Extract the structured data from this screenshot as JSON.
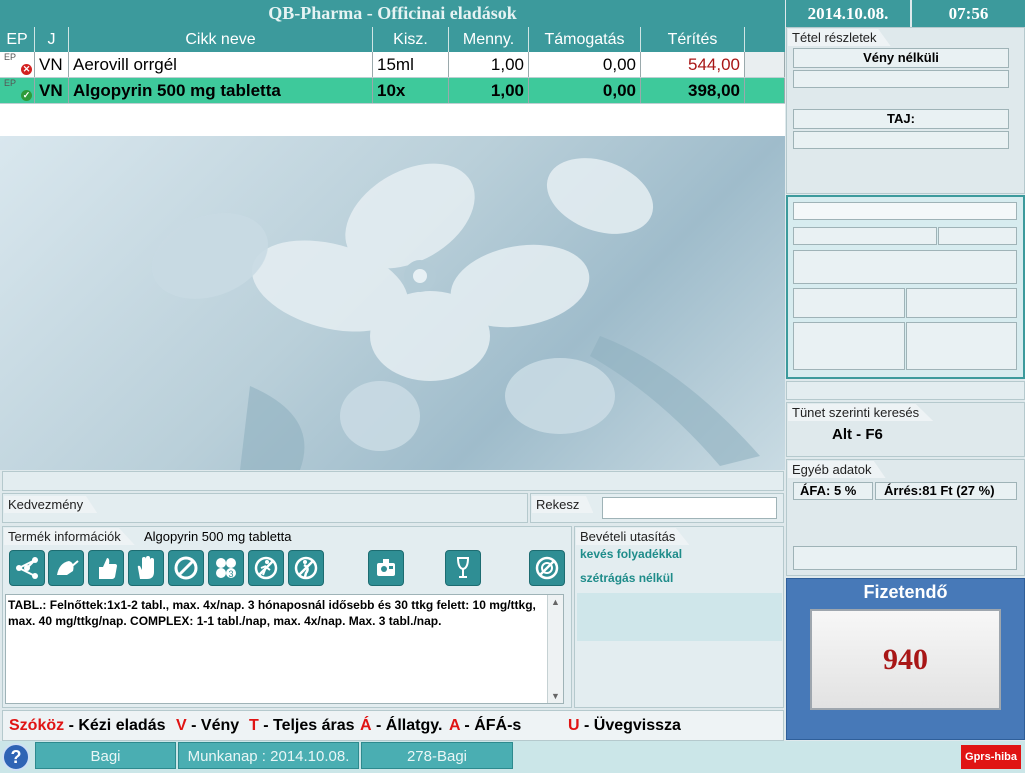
{
  "window": {
    "title": "QB-Pharma - Officinai eladások",
    "date": "2014.10.08.",
    "time": "07:56"
  },
  "table": {
    "headers": [
      "EP",
      "J",
      "Cikk neve",
      "Kisz.",
      "Menny.",
      "Támogatás",
      "Térítés"
    ],
    "rows": [
      {
        "ep": "EP",
        "j": "VN",
        "name": "Aerovill orrgél",
        "kisz": "15ml",
        "menny": "1,00",
        "tam": "0,00",
        "terites": "544,00",
        "status": "error"
      },
      {
        "ep": "EP",
        "j": "VN",
        "name": "Algopyrin 500 mg tabletta",
        "kisz": "10x",
        "menny": "1,00",
        "tam": "0,00",
        "terites": "398,00",
        "status": "ok"
      }
    ]
  },
  "discount": {
    "label": "Kedvezmény",
    "rekesz_label": "Rekesz",
    "rekesz_value": ""
  },
  "product_info": {
    "label": "Termék információk",
    "product": "Algopyrin 500 mg tabletta",
    "text": "TABL.:  Felnőttek:1x1-2 tabl., max. 4x/nap.  3 hónaposnál idősebb és 30 ttkg felett: 10 mg/ttkg, max. 40 mg/ttkg/nap. COMPLEX: 1-1 tabl./nap, max. 4x/nap. Max. 3 tabl./nap."
  },
  "intake": {
    "label": "Bevételi utasítás",
    "line1": "kevés folyadékkal",
    "line2": "szétrágás nélkül"
  },
  "detail": {
    "label": "Tétel részletek",
    "recept": "Vény nélküli",
    "taj": "TAJ:"
  },
  "symptom": {
    "label": "Tünet szerinti keresés",
    "shortcut": "Alt - F6"
  },
  "other": {
    "label": "Egyéb adatok",
    "afa": "ÁFA: 5 %",
    "arres": "Árrés:81 Ft  (27 %)"
  },
  "payment": {
    "label": "Fizetendő",
    "amount": "940"
  },
  "shortcuts": [
    {
      "key": "Szóköz",
      "text": " - Kézi eladás"
    },
    {
      "key": "V",
      "text": " - Vény"
    },
    {
      "key": "T",
      "text": " - Teljes áras"
    },
    {
      "key": "Á",
      "text": " - Állatgy."
    },
    {
      "key": "A",
      "text": " - ÁFÁ-s"
    },
    {
      "key": "U",
      "text": " - Üvegvissza"
    }
  ],
  "footer": {
    "user": "Bagi",
    "workday": "Munkanap : 2014.10.08.",
    "station": "278-Bagi",
    "status": "Gprs-hiba",
    "help": "?"
  },
  "colors": {
    "accent": "#3c9a9c",
    "selected_row": "#3ec99b",
    "shortcut_key": "#e01414",
    "amount": "#a81616"
  },
  "icons": [
    "network-icon",
    "inhale-icon",
    "thumb-icon",
    "hand-icon",
    "prohibited-icon",
    "pills-icon",
    "no-run-icon",
    "no-pregnant-icon",
    "camera-icon",
    "wine-icon",
    "no-drive-icon"
  ]
}
